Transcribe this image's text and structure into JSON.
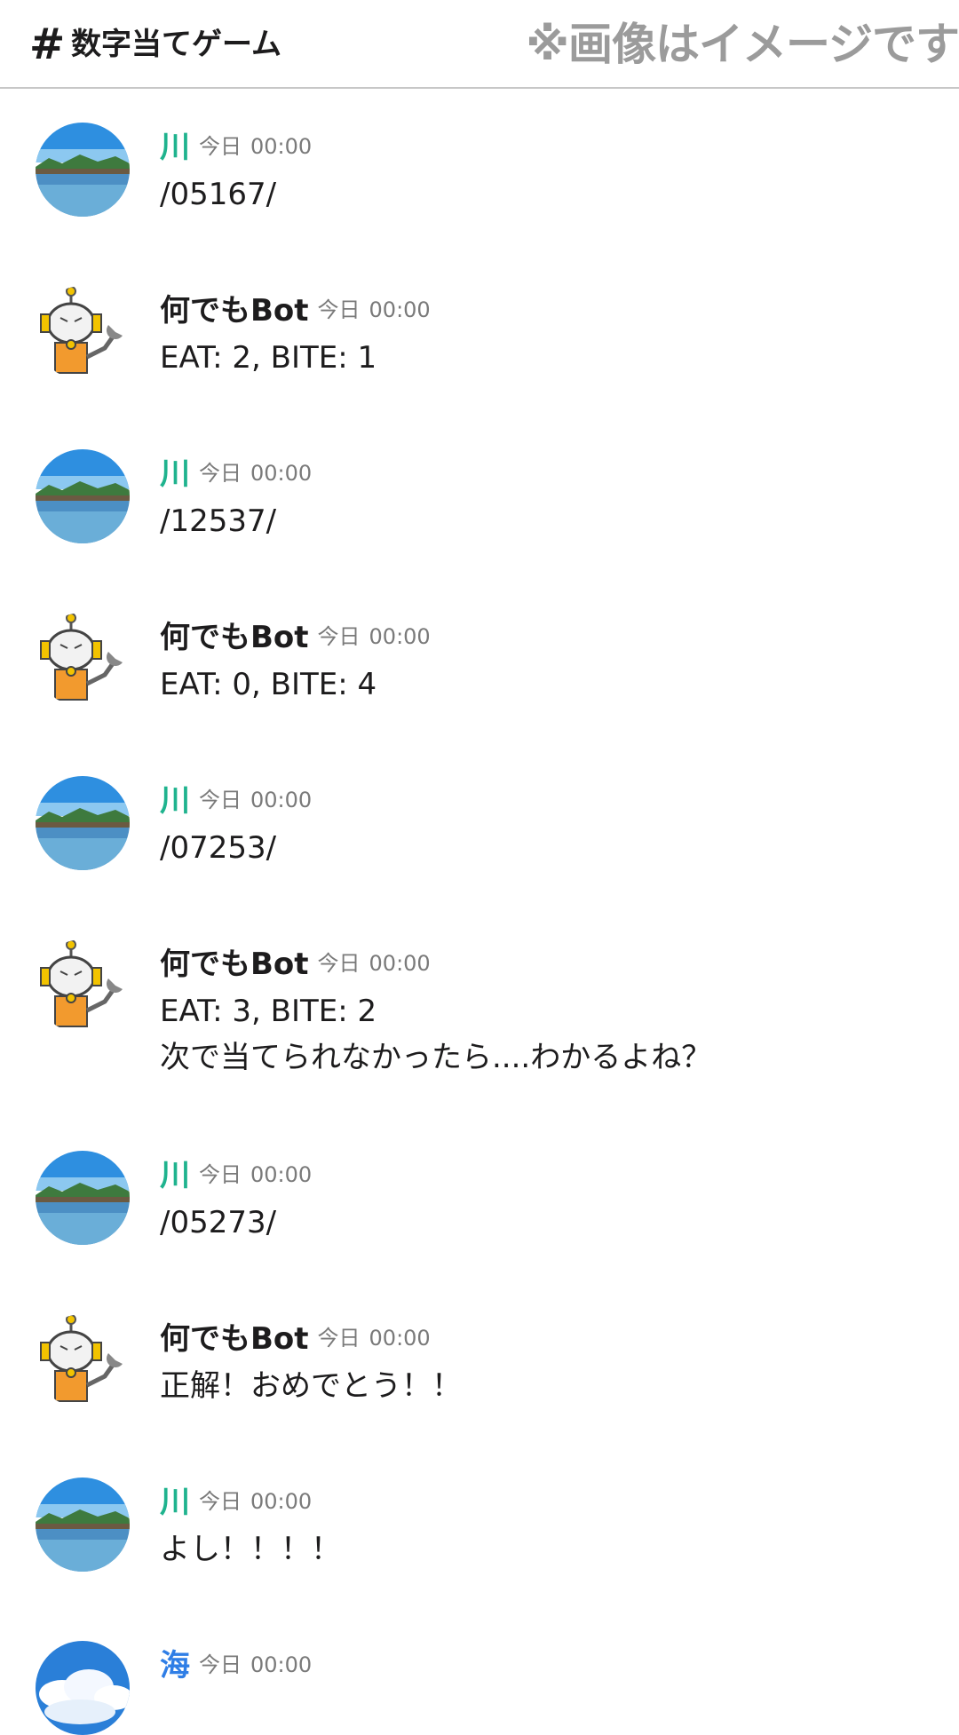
{
  "header": {
    "hash_symbol": "#",
    "channel_name": "数字当てゲーム",
    "watermark": "※画像はイメージです"
  },
  "messages": [
    {
      "user": "川",
      "day": "今日",
      "time": "00:00",
      "lines": [
        "/05167/"
      ]
    },
    {
      "user": "何でもBot",
      "day": "今日",
      "time": "00:00",
      "lines": [
        "EAT: 2, BITE: 1"
      ]
    },
    {
      "user": "川",
      "day": "今日",
      "time": "00:00",
      "lines": [
        "/12537/"
      ]
    },
    {
      "user": "何でもBot",
      "day": "今日",
      "time": "00:00",
      "lines": [
        "EAT: 0, BITE: 4"
      ]
    },
    {
      "user": "川",
      "day": "今日",
      "time": "00:00",
      "lines": [
        "/07253/"
      ]
    },
    {
      "user": "何でもBot",
      "day": "今日",
      "time": "00:00",
      "lines": [
        "EAT: 3, BITE: 2",
        "次で当てられなかったら....わかるよね？"
      ]
    },
    {
      "user": "川",
      "day": "今日",
      "time": "00:00",
      "lines": [
        "/05273/"
      ]
    },
    {
      "user": "何でもBot",
      "day": "今日",
      "time": "00:00",
      "lines": [
        "正解！おめでとう！！"
      ]
    },
    {
      "user": "川",
      "day": "今日",
      "time": "00:00",
      "lines": [
        "よし！！！！"
      ]
    },
    {
      "user": "海",
      "day": "今日",
      "time": "00:00",
      "lines": []
    }
  ],
  "colors": {
    "kawa_name": "#1fb38e",
    "umi_name": "#2f7ee6",
    "divider": "#c7c7c7",
    "watermark": "#9b9b9b"
  }
}
